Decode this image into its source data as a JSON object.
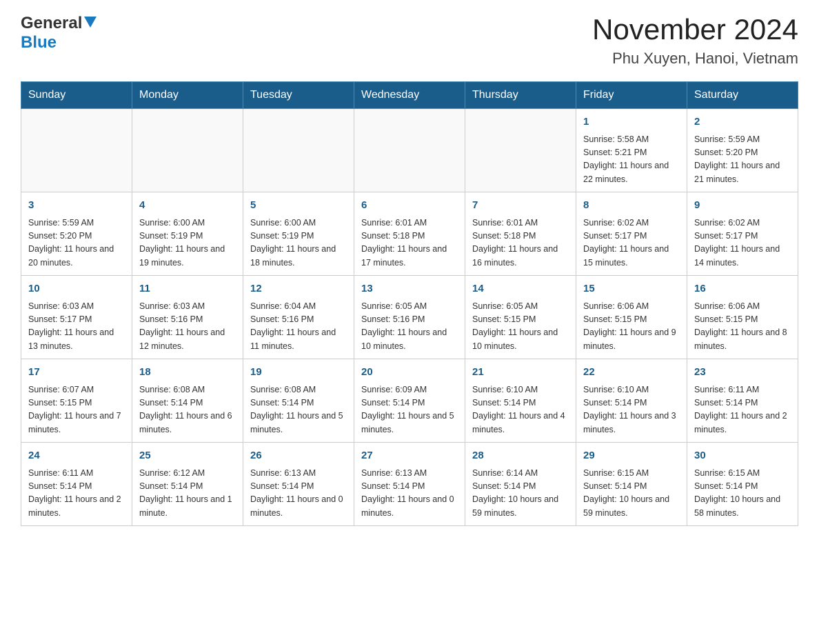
{
  "header": {
    "logo_general": "General",
    "logo_blue": "Blue",
    "title": "November 2024",
    "subtitle": "Phu Xuyen, Hanoi, Vietnam"
  },
  "days_of_week": [
    "Sunday",
    "Monday",
    "Tuesday",
    "Wednesday",
    "Thursday",
    "Friday",
    "Saturday"
  ],
  "weeks": [
    {
      "days": [
        {
          "num": "",
          "info": ""
        },
        {
          "num": "",
          "info": ""
        },
        {
          "num": "",
          "info": ""
        },
        {
          "num": "",
          "info": ""
        },
        {
          "num": "",
          "info": ""
        },
        {
          "num": "1",
          "info": "Sunrise: 5:58 AM\nSunset: 5:21 PM\nDaylight: 11 hours and 22 minutes."
        },
        {
          "num": "2",
          "info": "Sunrise: 5:59 AM\nSunset: 5:20 PM\nDaylight: 11 hours and 21 minutes."
        }
      ]
    },
    {
      "days": [
        {
          "num": "3",
          "info": "Sunrise: 5:59 AM\nSunset: 5:20 PM\nDaylight: 11 hours and 20 minutes."
        },
        {
          "num": "4",
          "info": "Sunrise: 6:00 AM\nSunset: 5:19 PM\nDaylight: 11 hours and 19 minutes."
        },
        {
          "num": "5",
          "info": "Sunrise: 6:00 AM\nSunset: 5:19 PM\nDaylight: 11 hours and 18 minutes."
        },
        {
          "num": "6",
          "info": "Sunrise: 6:01 AM\nSunset: 5:18 PM\nDaylight: 11 hours and 17 minutes."
        },
        {
          "num": "7",
          "info": "Sunrise: 6:01 AM\nSunset: 5:18 PM\nDaylight: 11 hours and 16 minutes."
        },
        {
          "num": "8",
          "info": "Sunrise: 6:02 AM\nSunset: 5:17 PM\nDaylight: 11 hours and 15 minutes."
        },
        {
          "num": "9",
          "info": "Sunrise: 6:02 AM\nSunset: 5:17 PM\nDaylight: 11 hours and 14 minutes."
        }
      ]
    },
    {
      "days": [
        {
          "num": "10",
          "info": "Sunrise: 6:03 AM\nSunset: 5:17 PM\nDaylight: 11 hours and 13 minutes."
        },
        {
          "num": "11",
          "info": "Sunrise: 6:03 AM\nSunset: 5:16 PM\nDaylight: 11 hours and 12 minutes."
        },
        {
          "num": "12",
          "info": "Sunrise: 6:04 AM\nSunset: 5:16 PM\nDaylight: 11 hours and 11 minutes."
        },
        {
          "num": "13",
          "info": "Sunrise: 6:05 AM\nSunset: 5:16 PM\nDaylight: 11 hours and 10 minutes."
        },
        {
          "num": "14",
          "info": "Sunrise: 6:05 AM\nSunset: 5:15 PM\nDaylight: 11 hours and 10 minutes."
        },
        {
          "num": "15",
          "info": "Sunrise: 6:06 AM\nSunset: 5:15 PM\nDaylight: 11 hours and 9 minutes."
        },
        {
          "num": "16",
          "info": "Sunrise: 6:06 AM\nSunset: 5:15 PM\nDaylight: 11 hours and 8 minutes."
        }
      ]
    },
    {
      "days": [
        {
          "num": "17",
          "info": "Sunrise: 6:07 AM\nSunset: 5:15 PM\nDaylight: 11 hours and 7 minutes."
        },
        {
          "num": "18",
          "info": "Sunrise: 6:08 AM\nSunset: 5:14 PM\nDaylight: 11 hours and 6 minutes."
        },
        {
          "num": "19",
          "info": "Sunrise: 6:08 AM\nSunset: 5:14 PM\nDaylight: 11 hours and 5 minutes."
        },
        {
          "num": "20",
          "info": "Sunrise: 6:09 AM\nSunset: 5:14 PM\nDaylight: 11 hours and 5 minutes."
        },
        {
          "num": "21",
          "info": "Sunrise: 6:10 AM\nSunset: 5:14 PM\nDaylight: 11 hours and 4 minutes."
        },
        {
          "num": "22",
          "info": "Sunrise: 6:10 AM\nSunset: 5:14 PM\nDaylight: 11 hours and 3 minutes."
        },
        {
          "num": "23",
          "info": "Sunrise: 6:11 AM\nSunset: 5:14 PM\nDaylight: 11 hours and 2 minutes."
        }
      ]
    },
    {
      "days": [
        {
          "num": "24",
          "info": "Sunrise: 6:11 AM\nSunset: 5:14 PM\nDaylight: 11 hours and 2 minutes."
        },
        {
          "num": "25",
          "info": "Sunrise: 6:12 AM\nSunset: 5:14 PM\nDaylight: 11 hours and 1 minute."
        },
        {
          "num": "26",
          "info": "Sunrise: 6:13 AM\nSunset: 5:14 PM\nDaylight: 11 hours and 0 minutes."
        },
        {
          "num": "27",
          "info": "Sunrise: 6:13 AM\nSunset: 5:14 PM\nDaylight: 11 hours and 0 minutes."
        },
        {
          "num": "28",
          "info": "Sunrise: 6:14 AM\nSunset: 5:14 PM\nDaylight: 10 hours and 59 minutes."
        },
        {
          "num": "29",
          "info": "Sunrise: 6:15 AM\nSunset: 5:14 PM\nDaylight: 10 hours and 59 minutes."
        },
        {
          "num": "30",
          "info": "Sunrise: 6:15 AM\nSunset: 5:14 PM\nDaylight: 10 hours and 58 minutes."
        }
      ]
    }
  ]
}
